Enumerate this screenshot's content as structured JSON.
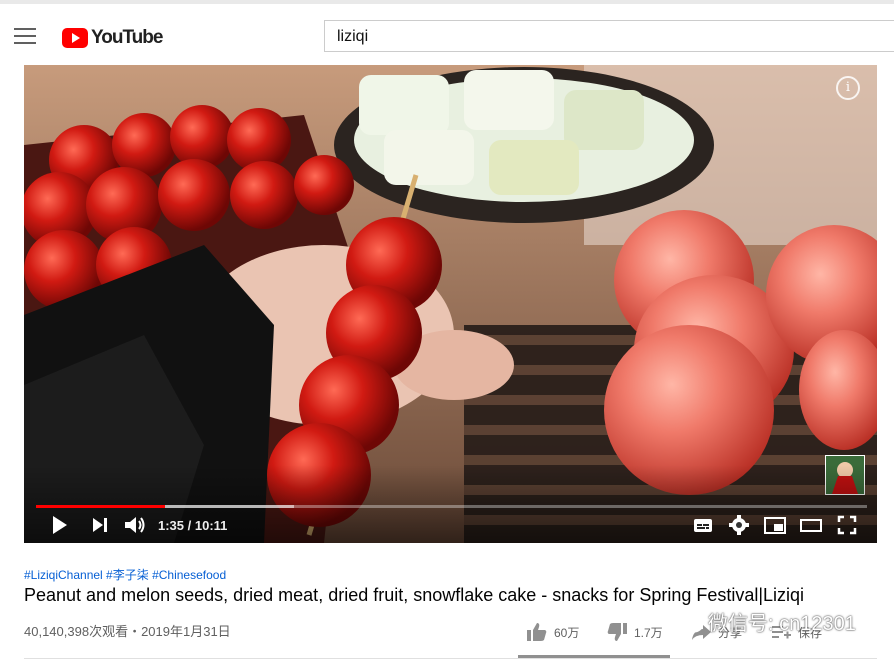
{
  "header": {
    "logo_text": "YouTube",
    "search_value": "liziqi"
  },
  "player": {
    "time_current": "1:35",
    "time_total": "10:11",
    "time_display": "1:35 / 10:11",
    "progress_played": 0.155,
    "progress_buffered": 0.31,
    "channel_watermark": "李子柒",
    "accent_color": "#ff0000"
  },
  "video": {
    "hashtags": "#LiziqiChannel #李子柒 #Chinesefood",
    "title": "Peanut and melon seeds, dried meat, dried fruit, snowflake cake - snacks for Spring Festival|Liziqi",
    "views_date": "40,140,398次观看・2019年1月31日",
    "likes": "60万",
    "dislikes": "1.7万",
    "share_label": "分享",
    "save_label": "保存"
  },
  "overlay": {
    "wechat_watermark": "微信号: cn12301"
  },
  "icons": [
    "menu-icon",
    "youtube-logo-icon",
    "play-icon",
    "next-icon",
    "volume-icon",
    "subtitles-icon",
    "settings-icon",
    "miniplayer-icon",
    "theater-icon",
    "fullscreen-icon",
    "info-icon",
    "thumbs-up-icon",
    "thumbs-down-icon",
    "share-icon",
    "save-icon",
    "wechat-icon"
  ]
}
